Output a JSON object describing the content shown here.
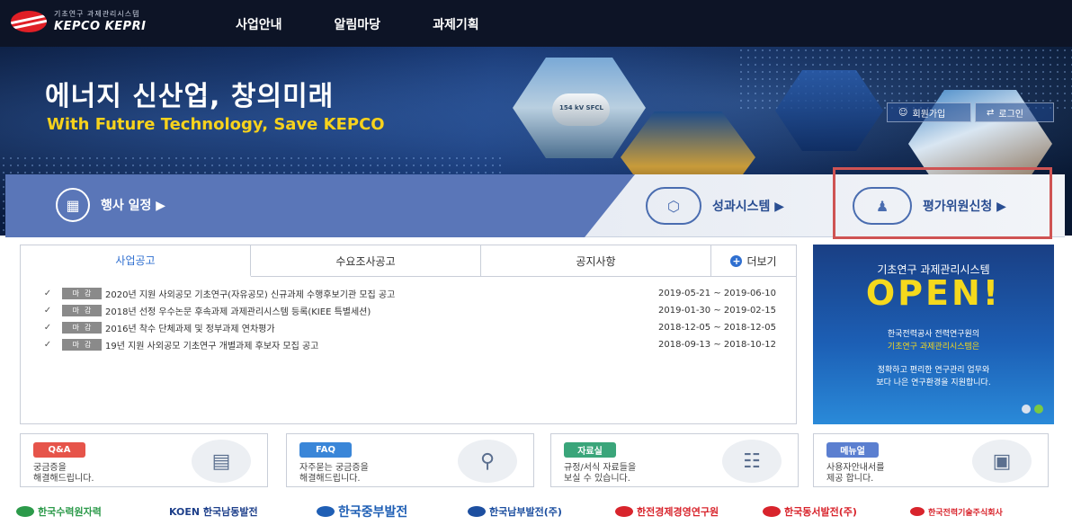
{
  "logo": {
    "sub": "기초연구 과제관리시스템",
    "main": "KEPCO KEPRI"
  },
  "nav": {
    "items": [
      "사업안내",
      "알림마당",
      "과제기획"
    ]
  },
  "hero": {
    "title": "에너지 신산업, 창의미래",
    "subtitle": "With Future Technology, Save KEPCO",
    "photo_label": "154 kV SFCL",
    "join_label": "회원가입",
    "login_label": "로그인"
  },
  "quick": {
    "event_label": "행사 일정 ▶",
    "performance_label": "성과시스템 ▶",
    "evaluator_label": "평가위원신청 ▶"
  },
  "notice": {
    "tabs": [
      "사업공고",
      "수요조사공고",
      "공지사항"
    ],
    "more_label": "더보기",
    "rows": [
      {
        "badge": "마감",
        "title": "2020년 지원 사외공모 기초연구(자유공모) 신규과제 수행후보기관 모집 공고",
        "date": "2019-05-21 ~ 2019-06-10"
      },
      {
        "badge": "마감",
        "title": "2018년 선정 우수논문 후속과제 과제관리시스템 등록(KIEE 특별세션)",
        "date": "2019-01-30 ~ 2019-02-15"
      },
      {
        "badge": "마감",
        "title": "2016년 착수 단체과제 및 정부과제 연차평가",
        "date": "2018-12-05 ~ 2018-12-05"
      },
      {
        "badge": "마감",
        "title": "19년 지원 사외공모 기초연구 개별과제 후보자 모집 공고",
        "date": "2018-09-13 ~ 2018-10-12"
      }
    ]
  },
  "promo": {
    "subtitle": "기초연구 과제관리시스템",
    "headline": "OPEN!",
    "line1": "한국전력공사 전력연구원의",
    "line2": "기초연구 과제관리시스템은",
    "line3": "정확하고 편리한 연구관리 업무와",
    "line4": "보다 나은 연구환경을 지원합니다."
  },
  "cards": [
    {
      "tag": "Q&A",
      "desc1": "궁금증을",
      "desc2": "해결해드립니다.",
      "color": "#e6544a",
      "icon": "qna-document-icon"
    },
    {
      "tag": "FAQ",
      "desc1": "자주묻는 궁금증을",
      "desc2": "해결해드립니다.",
      "color": "#3a86d8",
      "icon": "faq-magnifier-icon"
    },
    {
      "tag": "자료실",
      "desc1": "규정/서식 자료들을",
      "desc2": "보실 수 있습니다.",
      "color": "#3aa57a",
      "icon": "archive-board-icon"
    },
    {
      "tag": "메뉴얼",
      "desc1": "사용자안내서를",
      "desc2": "제공 합니다.",
      "color": "#5b7fd0",
      "icon": "manual-monitor-icon"
    }
  ],
  "partners": [
    {
      "name": "한국수력원자력",
      "color": "#2c9a4a"
    },
    {
      "name": "KOEN 한국남동발전",
      "color": "#1d3f8a"
    },
    {
      "name": "한국중부발전",
      "color": "#1f5fb5"
    },
    {
      "name": "한국남부발전(주)",
      "color": "#1d4fa0"
    },
    {
      "name": "한전경제경영연구원",
      "color": "#d8242c"
    },
    {
      "name": "한국동서발전(주)",
      "color": "#d8242c"
    },
    {
      "name": "한국전력기술주식회사",
      "color": "#d8242c"
    }
  ]
}
